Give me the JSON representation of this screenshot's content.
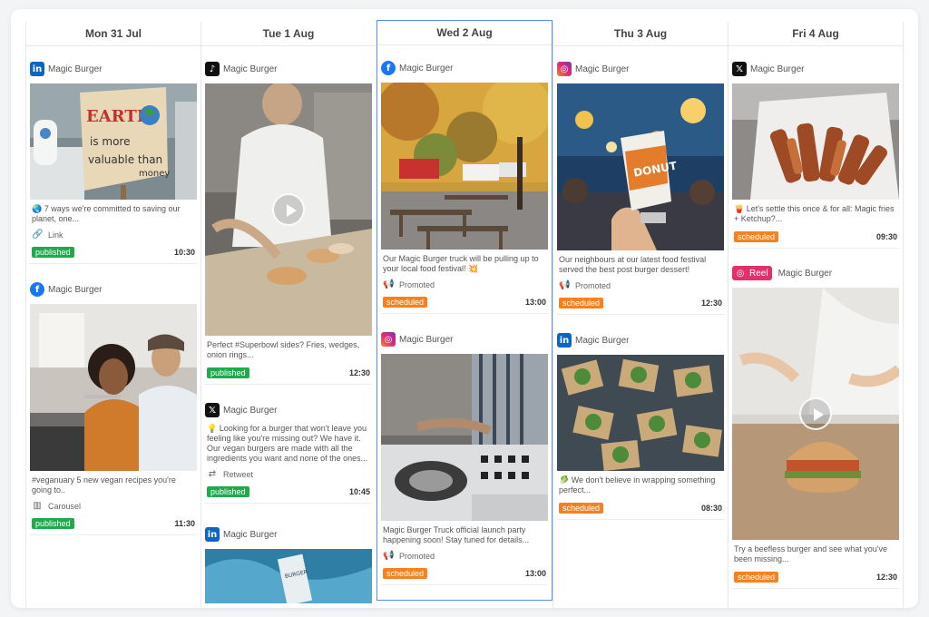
{
  "colors": {
    "selected_border": "#5a8df2",
    "published": "#1faa4b",
    "scheduled": "#f5821f"
  },
  "columns": [
    {
      "header": "Mon 31 Jul",
      "posts": [
        {
          "network": "linkedin",
          "account": "Magic Burger",
          "caption": "🌏 7 ways we're committed to saving our planet, one...",
          "meta": "Link",
          "status": "published",
          "time": "10:30"
        },
        {
          "network": "facebook",
          "account": "Magic Burger",
          "caption": "#veganuary 5 new vegan recipes you're going to..",
          "meta": "Carousel",
          "status": "published",
          "time": "11:30"
        }
      ]
    },
    {
      "header": "Tue 1 Aug",
      "posts": [
        {
          "network": "tiktok",
          "account": "Magic Burger",
          "caption": "Perfect #Superbowl sides? Fries, wedges, onion rings...",
          "status": "published",
          "time": "12:30"
        },
        {
          "network": "x",
          "account": "Magic Burger",
          "caption": "💡 Looking for a burger that won't leave you feeling like you're missing out? We have it. Our vegan burgers are made with all the ingredients you want and none of the ones...",
          "meta": "Retweet",
          "status": "published",
          "time": "10:45"
        },
        {
          "network": "linkedin",
          "account": "Magic Burger"
        }
      ]
    },
    {
      "header": "Wed 2 Aug",
      "posts": [
        {
          "network": "facebook",
          "account": "Magic Burger",
          "caption": "Our Magic Burger truck will be pulling up to your local food festival! 💥",
          "meta": "Promoted",
          "status": "scheduled",
          "time": "13:00"
        },
        {
          "network": "instagram",
          "account": "Magic Burger",
          "caption": "Magic Burger Truck official launch party happening soon! Stay tuned for details...",
          "meta": "Promoted",
          "status": "scheduled",
          "time": "13:00"
        }
      ]
    },
    {
      "header": "Thu 3 Aug",
      "posts": [
        {
          "network": "instagram",
          "account": "Magic Burger",
          "caption": "Our neighbours at our latest food festival served the best post burger dessert!",
          "meta": "Promoted",
          "status": "scheduled",
          "time": "12:30"
        },
        {
          "network": "linkedin",
          "account": "Magic Burger",
          "caption": "🥬 We don't believe in wrapping something perfect...",
          "status": "scheduled",
          "time": "08:30"
        }
      ]
    },
    {
      "header": "Fri 4 Aug",
      "posts": [
        {
          "network": "x",
          "account": "Magic Burger",
          "caption": "🍟 Let's settle this once & for all: Magic fries + Ketchup?...",
          "status": "scheduled",
          "time": "09:30"
        },
        {
          "network": "instagram",
          "reel_label": "Reel",
          "account": "Magic Burger",
          "caption": "Try a beefless burger and see what you've been missing...",
          "status": "scheduled",
          "time": "12:30"
        }
      ]
    }
  ]
}
